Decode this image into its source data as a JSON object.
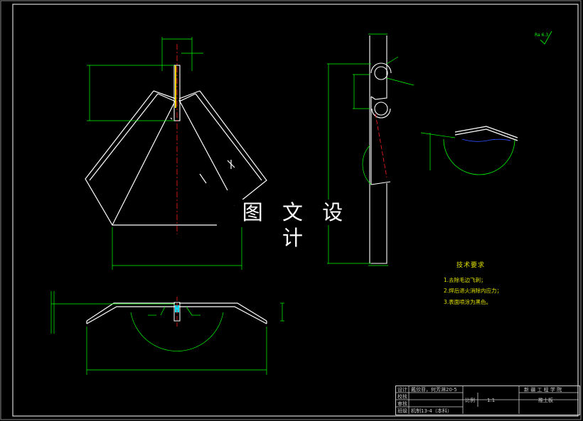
{
  "watermark": "图 文 设 计",
  "tech_requirements": {
    "title": "技术要求",
    "notes": [
      "1.去除毛边飞刺；",
      "2.焊后退火消除内应力；",
      "3.表面喷涂为黑色。"
    ]
  },
  "title_block": {
    "rows": [
      "设计",
      "校核",
      "审核",
      "班级"
    ],
    "designer": "戴欣菲，何芳淋20-5",
    "class_text": "机制13-4（本科）",
    "scale_label": "比例",
    "scale_value": "1:1",
    "school": "新 疆 工 程 学 院",
    "part_name": "推土板"
  },
  "roughness": "Ra 6.3",
  "colors": {
    "outline": "#ffffff",
    "dimension": "#00ff00",
    "center_line": "#ff2020",
    "weld": "#00ffff",
    "note": "#e0e000"
  }
}
